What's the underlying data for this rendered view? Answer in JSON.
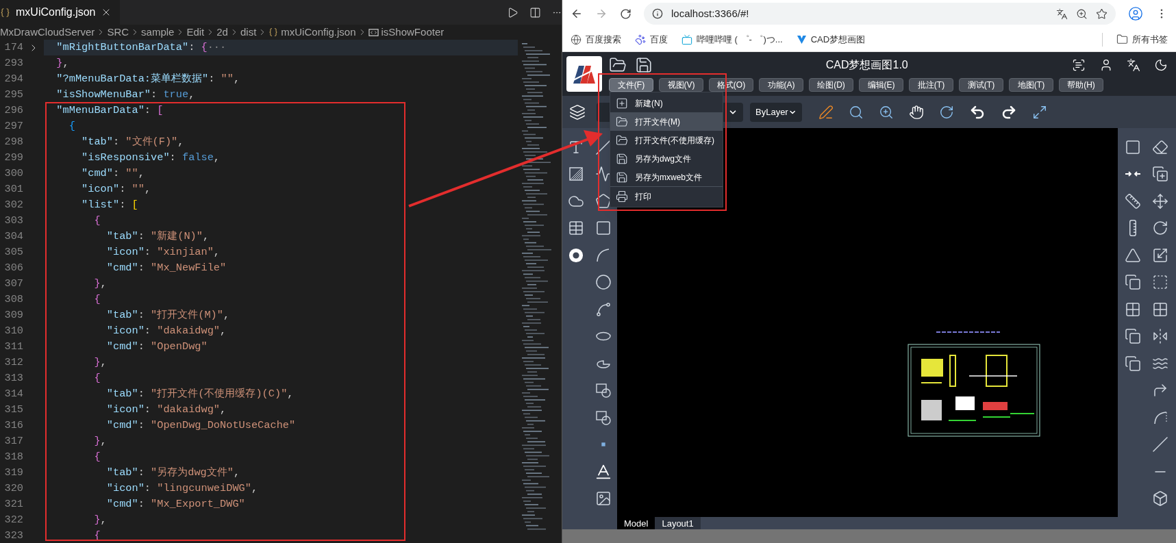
{
  "editor": {
    "tab": {
      "title": "mxUiConfig.json",
      "selected": true
    },
    "breadcrumb": [
      "MxDrawCloudServer",
      "SRC",
      "sample",
      "Edit",
      "2d",
      "dist",
      "mxUiConfig.json",
      "isShowFooter"
    ],
    "lines": [
      {
        "number": "174",
        "folded": true,
        "tokens": [
          {
            "kind": "key",
            "text": "\"mRightButtonBarData\""
          },
          {
            "kind": "p",
            "text": ":"
          },
          {
            "kind": "b2",
            "text": "{"
          },
          {
            "kind": "dim",
            "text": "···"
          }
        ]
      },
      {
        "number": "293",
        "folded": false,
        "tokens": [
          {
            "kind": "b2",
            "text": "}"
          },
          {
            "kind": "p",
            "text": ","
          }
        ]
      },
      {
        "number": "294",
        "folded": false,
        "tokens": [
          {
            "kind": "key",
            "text": "\"?mMenuBarData:菜单栏数据\""
          },
          {
            "kind": "p",
            "text": ":"
          },
          {
            "kind": "str",
            "text": "\"\""
          },
          {
            "kind": "p",
            "text": ","
          }
        ]
      },
      {
        "number": "295",
        "folded": false,
        "tokens": [
          {
            "kind": "key",
            "text": "\"isShowMenuBar\""
          },
          {
            "kind": "p",
            "text": ":"
          },
          {
            "kind": "kw",
            "text": "true"
          },
          {
            "kind": "p",
            "text": ","
          }
        ]
      },
      {
        "number": "296",
        "folded": false,
        "tokens": [
          {
            "kind": "key",
            "text": "\"mMenuBarData\""
          },
          {
            "kind": "p",
            "text": ":"
          },
          {
            "kind": "b2",
            "text": "["
          }
        ]
      },
      {
        "number": "297",
        "folded": false,
        "tokens": [
          {
            "kind": "b3",
            "text": "{"
          }
        ]
      },
      {
        "number": "298",
        "folded": false,
        "tokens": [
          {
            "kind": "key",
            "text": "\"tab\""
          },
          {
            "kind": "p",
            "text": ":"
          },
          {
            "kind": "str",
            "text": "\"文件(F)\""
          },
          {
            "kind": "p",
            "text": ","
          }
        ]
      },
      {
        "number": "299",
        "folded": false,
        "tokens": [
          {
            "kind": "key",
            "text": "\"isResponsive\""
          },
          {
            "kind": "p",
            "text": ":"
          },
          {
            "kind": "kw",
            "text": "false"
          },
          {
            "kind": "p",
            "text": ","
          }
        ]
      },
      {
        "number": "300",
        "folded": false,
        "tokens": [
          {
            "kind": "key",
            "text": "\"cmd\""
          },
          {
            "kind": "p",
            "text": ":"
          },
          {
            "kind": "str",
            "text": "\"\""
          },
          {
            "kind": "p",
            "text": ","
          }
        ]
      },
      {
        "number": "301",
        "folded": false,
        "tokens": [
          {
            "kind": "key",
            "text": "\"icon\""
          },
          {
            "kind": "p",
            "text": ":"
          },
          {
            "kind": "str",
            "text": "\"\""
          },
          {
            "kind": "p",
            "text": ","
          }
        ]
      },
      {
        "number": "302",
        "folded": false,
        "tokens": [
          {
            "kind": "key",
            "text": "\"list\""
          },
          {
            "kind": "p",
            "text": ":"
          },
          {
            "kind": "b1",
            "text": "["
          }
        ]
      },
      {
        "number": "303",
        "folded": false,
        "tokens": [
          {
            "kind": "b2",
            "text": "{"
          }
        ]
      },
      {
        "number": "304",
        "folded": false,
        "tokens": [
          {
            "kind": "key",
            "text": "\"tab\""
          },
          {
            "kind": "p",
            "text": ":"
          },
          {
            "kind": "str",
            "text": "\"新建(N)\""
          },
          {
            "kind": "p",
            "text": ","
          }
        ]
      },
      {
        "number": "305",
        "folded": false,
        "tokens": [
          {
            "kind": "key",
            "text": "\"icon\""
          },
          {
            "kind": "p",
            "text": ":"
          },
          {
            "kind": "str",
            "text": "\"xinjian\""
          },
          {
            "kind": "p",
            "text": ","
          }
        ]
      },
      {
        "number": "306",
        "folded": false,
        "tokens": [
          {
            "kind": "key",
            "text": "\"cmd\""
          },
          {
            "kind": "p",
            "text": ":"
          },
          {
            "kind": "str",
            "text": "\"Mx_NewFile\""
          }
        ]
      },
      {
        "number": "307",
        "folded": false,
        "tokens": [
          {
            "kind": "b2",
            "text": "}"
          },
          {
            "kind": "p",
            "text": ","
          }
        ]
      },
      {
        "number": "308",
        "folded": false,
        "tokens": [
          {
            "kind": "b2",
            "text": "{"
          }
        ]
      },
      {
        "number": "309",
        "folded": false,
        "tokens": [
          {
            "kind": "key",
            "text": "\"tab\""
          },
          {
            "kind": "p",
            "text": ":"
          },
          {
            "kind": "str",
            "text": "\"打开文件(M)\""
          },
          {
            "kind": "p",
            "text": ","
          }
        ]
      },
      {
        "number": "310",
        "folded": false,
        "tokens": [
          {
            "kind": "key",
            "text": "\"icon\""
          },
          {
            "kind": "p",
            "text": ":"
          },
          {
            "kind": "str",
            "text": "\"dakaidwg\""
          },
          {
            "kind": "p",
            "text": ","
          }
        ]
      },
      {
        "number": "311",
        "folded": false,
        "tokens": [
          {
            "kind": "key",
            "text": "\"cmd\""
          },
          {
            "kind": "p",
            "text": ":"
          },
          {
            "kind": "str",
            "text": "\"OpenDwg\""
          }
        ]
      },
      {
        "number": "312",
        "folded": false,
        "tokens": [
          {
            "kind": "b2",
            "text": "}"
          },
          {
            "kind": "p",
            "text": ","
          }
        ]
      },
      {
        "number": "313",
        "folded": false,
        "tokens": [
          {
            "kind": "b2",
            "text": "{"
          }
        ]
      },
      {
        "number": "314",
        "folded": false,
        "tokens": [
          {
            "kind": "key",
            "text": "\"tab\""
          },
          {
            "kind": "p",
            "text": ":"
          },
          {
            "kind": "str",
            "text": "\"打开文件(不使用缓存)(C)\""
          },
          {
            "kind": "p",
            "text": ","
          }
        ]
      },
      {
        "number": "315",
        "folded": false,
        "tokens": [
          {
            "kind": "key",
            "text": "\"icon\""
          },
          {
            "kind": "p",
            "text": ":"
          },
          {
            "kind": "str",
            "text": "\"dakaidwg\""
          },
          {
            "kind": "p",
            "text": ","
          }
        ]
      },
      {
        "number": "316",
        "folded": false,
        "tokens": [
          {
            "kind": "key",
            "text": "\"cmd\""
          },
          {
            "kind": "p",
            "text": ":"
          },
          {
            "kind": "str",
            "text": "\"OpenDwg_DoNotUseCache\""
          }
        ]
      },
      {
        "number": "317",
        "folded": false,
        "tokens": [
          {
            "kind": "b2",
            "text": "}"
          },
          {
            "kind": "p",
            "text": ","
          }
        ]
      },
      {
        "number": "318",
        "folded": false,
        "tokens": [
          {
            "kind": "b2",
            "text": "{"
          }
        ]
      },
      {
        "number": "319",
        "folded": false,
        "tokens": [
          {
            "kind": "key",
            "text": "\"tab\""
          },
          {
            "kind": "p",
            "text": ":"
          },
          {
            "kind": "str",
            "text": "\"另存为dwg文件\""
          },
          {
            "kind": "p",
            "text": ","
          }
        ]
      },
      {
        "number": "320",
        "folded": false,
        "tokens": [
          {
            "kind": "key",
            "text": "\"icon\""
          },
          {
            "kind": "p",
            "text": ":"
          },
          {
            "kind": "str",
            "text": "\"lingcunweiDWG\""
          },
          {
            "kind": "p",
            "text": ","
          }
        ]
      },
      {
        "number": "321",
        "folded": false,
        "tokens": [
          {
            "kind": "key",
            "text": "\"cmd\""
          },
          {
            "kind": "p",
            "text": ":"
          },
          {
            "kind": "str",
            "text": "\"Mx_Export_DWG\""
          }
        ]
      },
      {
        "number": "322",
        "folded": false,
        "tokens": [
          {
            "kind": "b2",
            "text": "}"
          },
          {
            "kind": "p",
            "text": ","
          }
        ]
      },
      {
        "number": "323",
        "folded": false,
        "tokens": [
          {
            "kind": "b2",
            "text": "{"
          }
        ]
      }
    ]
  },
  "browser": {
    "url": "localhost:3366/#!",
    "bookmarks": [
      "百度搜索",
      "百度",
      "哔哩哔哩 ( ゜- ゜)つ...",
      "CAD梦想画图"
    ],
    "all_bookmarks": "所有书签"
  },
  "app": {
    "title": "CAD梦想画图1.0",
    "menu": [
      {
        "label": "文件(F)",
        "selected": true
      },
      {
        "label": "视图(V)",
        "selected": false
      },
      {
        "label": "格式(O)",
        "selected": false
      },
      {
        "label": "功能(A)",
        "selected": false
      },
      {
        "label": "绘图(D)",
        "selected": false
      },
      {
        "label": "编辑(E)",
        "selected": false
      },
      {
        "label": "批注(T)",
        "selected": false
      },
      {
        "label": "测试(T)",
        "selected": false
      },
      {
        "label": "地图(T)",
        "selected": false
      },
      {
        "label": "帮助(H)",
        "selected": false
      }
    ],
    "file_menu": {
      "groups": [
        [
          {
            "label": "新建(N)",
            "selected": false
          },
          {
            "label": "打开文件(M)",
            "selected": true
          },
          {
            "label": "打开文件(不使用缓存)",
            "selected": false
          },
          {
            "label": "另存为dwg文件",
            "selected": false
          },
          {
            "label": "另存为mxweb文件",
            "selected": false
          }
        ],
        [
          {
            "label": "打印",
            "selected": false
          }
        ]
      ]
    },
    "linetype": {
      "value": "ByLayer"
    },
    "layout_tabs": [
      {
        "label": "Model",
        "selected": true
      },
      {
        "label": "Layout1",
        "selected": false
      }
    ]
  }
}
